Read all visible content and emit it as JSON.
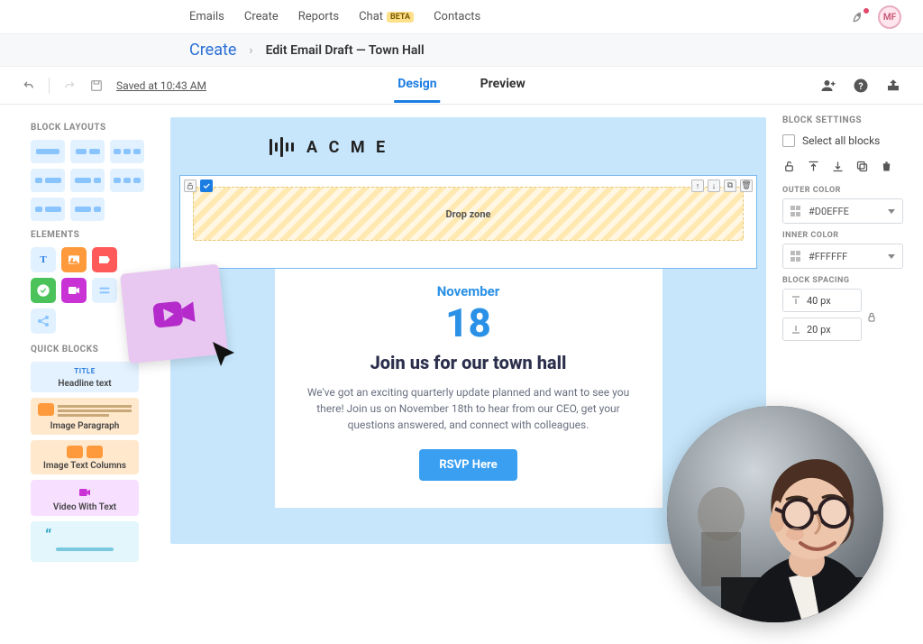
{
  "nav": {
    "items": [
      "Emails",
      "Create",
      "Reports",
      "Chat",
      "Contacts"
    ],
    "chat_badge": "BETA",
    "avatar_initials": "MF"
  },
  "breadcrumb": {
    "root": "Create",
    "leaf": "Edit Email Draft — Town Hall"
  },
  "toolbar": {
    "saved_label": "Saved at 10:43 AM",
    "tabs": {
      "design": "Design",
      "preview": "Preview"
    }
  },
  "left_panel": {
    "layouts_title": "BLOCK LAYOUTS",
    "elements_title": "ELEMENTS",
    "quick_title": "QUICK BLOCKS",
    "quick": [
      {
        "tag": "TITLE",
        "caption": "Headline text"
      },
      {
        "tag": "",
        "caption": "Image Paragraph"
      },
      {
        "tag": "",
        "caption": "Image Text Columns"
      },
      {
        "tag": "",
        "caption": "Video With Text"
      },
      {
        "tag": "",
        "caption": ""
      }
    ]
  },
  "canvas": {
    "brand": "A C M E",
    "dropzone": "Drop zone",
    "email": {
      "month": "November",
      "day": "18",
      "headline": "Join us for our town hall",
      "paragraph": "We've got an exciting quarterly update planned and want to see you there! Join us on November 18th to hear from our CEO, get your questions answered, and connect with colleagues.",
      "cta": "RSVP Here"
    }
  },
  "right_panel": {
    "title": "BLOCK SETTINGS",
    "select_all": "Select all blocks",
    "outer_color_label": "OUTER COLOR",
    "outer_color_value": "#D0EFFE",
    "inner_color_label": "INNER COLOR",
    "inner_color_value": "#FFFFFF",
    "spacing_label": "BLOCK SPACING",
    "spacing_top": "40 px",
    "spacing_bottom": "20 px"
  }
}
